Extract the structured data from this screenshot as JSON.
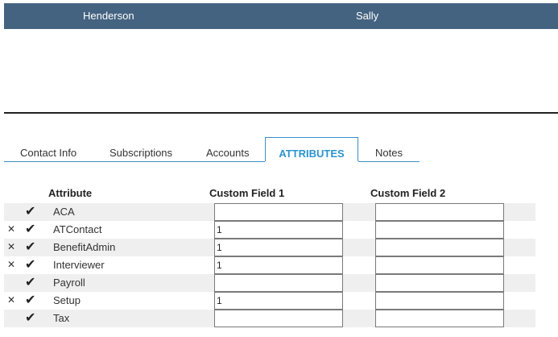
{
  "header": {
    "last_name": "Henderson",
    "first_name": "Sally"
  },
  "tabs": [
    {
      "label": "Contact Info"
    },
    {
      "label": "Subscriptions"
    },
    {
      "label": "Accounts"
    },
    {
      "label": "ATTRIBUTES",
      "active": true
    },
    {
      "label": "Notes"
    }
  ],
  "table": {
    "columns": [
      "Attribute",
      "Custom Field 1",
      "Custom Field 2"
    ],
    "rows": [
      {
        "name": "ACA",
        "removable": false,
        "checked": true,
        "field1": "",
        "field2": ""
      },
      {
        "name": "ATContact",
        "removable": true,
        "checked": true,
        "field1": "1",
        "field2": ""
      },
      {
        "name": "BenefitAdmin",
        "removable": true,
        "checked": true,
        "field1": "1",
        "field2": ""
      },
      {
        "name": "Interviewer",
        "removable": true,
        "checked": true,
        "field1": "1",
        "field2": ""
      },
      {
        "name": "Payroll",
        "removable": false,
        "checked": true,
        "field1": "",
        "field2": ""
      },
      {
        "name": "Setup",
        "removable": true,
        "checked": true,
        "field1": "1",
        "field2": ""
      },
      {
        "name": "Tax",
        "removable": false,
        "checked": true,
        "field1": "",
        "field2": ""
      }
    ]
  },
  "icons": {
    "remove": "close-icon",
    "check": "checkmark-icon"
  },
  "colors": {
    "header_bg": "#446380",
    "accent": "#2b94d2",
    "row_alt": "#efefef"
  }
}
